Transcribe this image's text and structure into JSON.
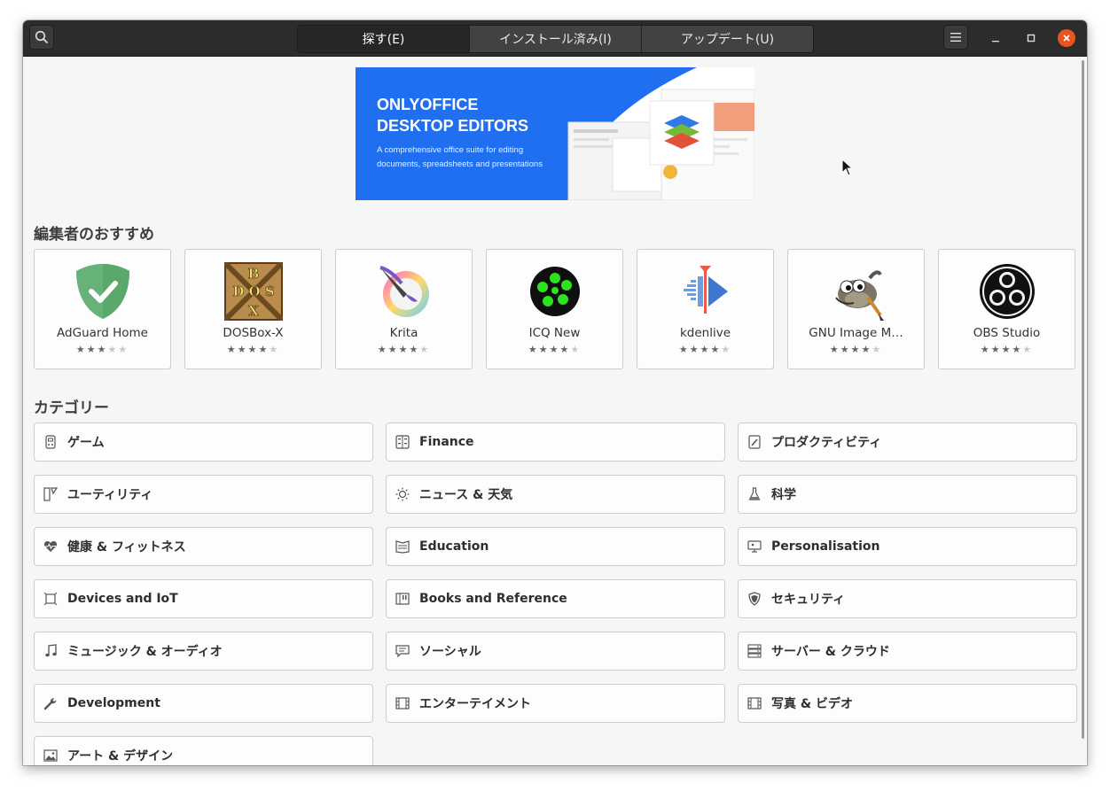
{
  "header": {
    "tabs": [
      {
        "label": "探す(E)",
        "active": true
      },
      {
        "label": "インストール済み(I)",
        "active": false
      },
      {
        "label": "アップデート(U)",
        "active": false
      }
    ],
    "search_icon": "search-icon",
    "menu_icon": "hamburger-menu-icon"
  },
  "banner": {
    "title_line1": "ONLYOFFICE",
    "title_line2": "DESKTOP EDITORS",
    "subtitle_line1": "A comprehensive office suite for editing",
    "subtitle_line2": "documents, spreadsheets and presentations"
  },
  "featured": {
    "title": "編集者のおすすめ",
    "apps": [
      {
        "name": "AdGuard Home",
        "rating": 3
      },
      {
        "name": "DOSBox-X",
        "rating": 4
      },
      {
        "name": "Krita",
        "rating": 4
      },
      {
        "name": "ICQ New",
        "rating": 4
      },
      {
        "name": "kdenlive",
        "rating": 4
      },
      {
        "name": "GNU Image M…",
        "rating": 4
      },
      {
        "name": "OBS Studio",
        "rating": 4
      }
    ]
  },
  "categories": {
    "title": "カテゴリー",
    "items": [
      {
        "label": "ゲーム",
        "icon": "gamepad-icon"
      },
      {
        "label": "Finance",
        "icon": "calculator-icon"
      },
      {
        "label": "プロダクティビティ",
        "icon": "edit-icon"
      },
      {
        "label": "ユーティリティ",
        "icon": "utilities-icon"
      },
      {
        "label": "ニュース & 天気",
        "icon": "sun-icon"
      },
      {
        "label": "科学",
        "icon": "flask-icon"
      },
      {
        "label": "健康 & フィットネス",
        "icon": "heart-pulse-icon"
      },
      {
        "label": "Education",
        "icon": "book-open-icon"
      },
      {
        "label": "Personalisation",
        "icon": "monitor-icon"
      },
      {
        "label": "Devices and IoT",
        "icon": "device-icon"
      },
      {
        "label": "Books and Reference",
        "icon": "books-icon"
      },
      {
        "label": "セキュリティ",
        "icon": "shield-icon"
      },
      {
        "label": "ミュージック & オーディオ",
        "icon": "music-note-icon"
      },
      {
        "label": "ソーシャル",
        "icon": "chat-bubble-icon"
      },
      {
        "label": "サーバー & クラウド",
        "icon": "server-icon"
      },
      {
        "label": "Development",
        "icon": "wrench-icon"
      },
      {
        "label": "エンターテイメント",
        "icon": "film-icon"
      },
      {
        "label": "写真 & ビデオ",
        "icon": "film-icon"
      },
      {
        "label": "アート & デザイン",
        "icon": "image-icon"
      }
    ]
  }
}
